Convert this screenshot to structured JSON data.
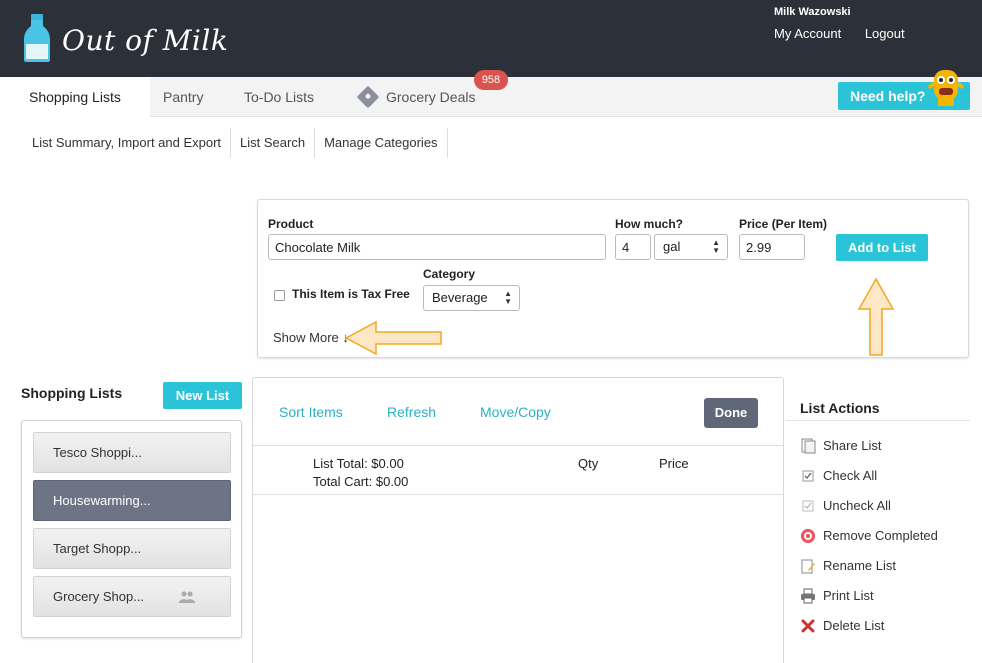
{
  "brand": {
    "logo_text": "Out of Milk"
  },
  "user": {
    "name": "Milk Wazowski",
    "my_account": "My Account",
    "logout": "Logout"
  },
  "nav": {
    "tabs": [
      {
        "label": "Shopping Lists",
        "active": true
      },
      {
        "label": "Pantry"
      },
      {
        "label": "To-Do Lists"
      },
      {
        "label": "Grocery Deals",
        "icon": "tag-icon"
      }
    ],
    "deals_badge": "958",
    "help_label": "Need help?"
  },
  "subnav": [
    "List Summary, Import and Export",
    "List Search",
    "Manage Categories"
  ],
  "add_item": {
    "product_label": "Product",
    "product_value": "Chocolate Milk",
    "how_much_label": "How much?",
    "quantity_value": "4",
    "unit_value": "gal",
    "price_label": "Price (Per Item)",
    "price_value": "2.99",
    "add_button": "Add to List",
    "category_label": "Category",
    "category_value": "Beverage",
    "tax_free_label": "This Item is Tax Free",
    "show_more": "Show More ↓"
  },
  "sidebar": {
    "title": "Shopping Lists",
    "new_list_button": "New List",
    "lists": [
      {
        "label": "Tesco Shoppi..."
      },
      {
        "label": "Housewarming...",
        "selected": true
      },
      {
        "label": "Target Shopp..."
      },
      {
        "label": "Grocery Shop...",
        "shared": true
      }
    ]
  },
  "list_view": {
    "sort_items": "Sort Items",
    "refresh": "Refresh",
    "move_copy": "Move/Copy",
    "done": "Done",
    "list_total": "List Total: $0.00",
    "total_cart": "Total Cart: $0.00",
    "qty_header": "Qty",
    "price_header": "Price"
  },
  "list_actions": {
    "title": "List Actions",
    "items": [
      {
        "label": "Share List",
        "icon": "share-icon"
      },
      {
        "label": "Check All",
        "icon": "check-all-icon"
      },
      {
        "label": "Uncheck All",
        "icon": "uncheck-all-icon"
      },
      {
        "label": "Remove Completed",
        "icon": "remove-completed-icon"
      },
      {
        "label": "Rename List",
        "icon": "rename-icon"
      },
      {
        "label": "Print List",
        "icon": "printer-icon"
      },
      {
        "label": "Delete List",
        "icon": "delete-x-icon"
      }
    ]
  },
  "colors": {
    "header_bg": "#2c3038",
    "accent": "#2bc3d7",
    "link": "#2bb0c7",
    "selected_list": "#6d7485",
    "badge": "#d9534f",
    "annotation_arrow": "#f5a623"
  }
}
